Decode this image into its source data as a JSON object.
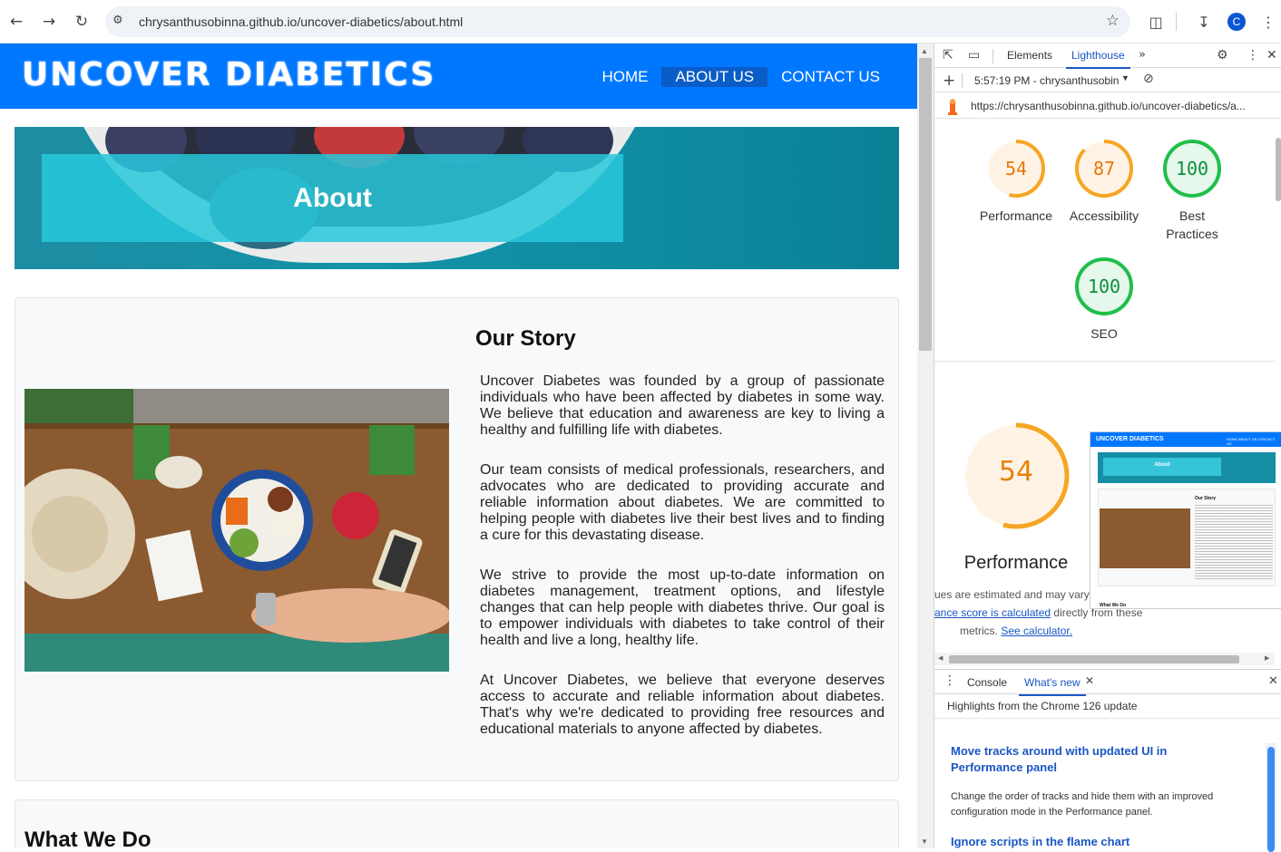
{
  "browser": {
    "url": "chrysanthusobinna.github.io/uncover-diabetics/about.html",
    "profile_initial": "C"
  },
  "site": {
    "brand": "UNCOVER DIABETICS",
    "nav": [
      {
        "label": "HOME",
        "active": false
      },
      {
        "label": "ABOUT US",
        "active": true
      },
      {
        "label": "CONTACT US",
        "active": false
      }
    ],
    "hero_title": "About",
    "story": {
      "heading": "Our Story",
      "paragraphs": [
        "Uncover Diabetes was founded by a group of passionate individuals who have been affected by diabetes in some way. We believe that education and awareness are key to living a healthy and fulfilling life with diabetes.",
        "Our team consists of medical professionals, researchers, and advocates who are dedicated to providing accurate and reliable information about diabetes. We are committed to helping people with diabetes live their best lives and to finding a cure for this devastating disease.",
        "We strive to provide the most up-to-date information on diabetes management, treatment options, and lifestyle changes that can help people with diabetes thrive. Our goal is to empower individuals with diabetes to take control of their health and live a long, healthy life.",
        "At Uncover Diabetes, we believe that everyone deserves access to accurate and reliable information about diabetes. That's why we're dedicated to providing free resources and educational materials to anyone affected by diabetes."
      ]
    },
    "what_we_do_heading": "What We Do"
  },
  "devtools": {
    "tabs": [
      "Elements",
      "Lighthouse"
    ],
    "active_tab": "Lighthouse",
    "report_time": "5:57:19 PM - chrysanthusobinr",
    "report_url": "https://chrysanthusobinna.github.io/uncover-diabetics/a...",
    "scores": [
      {
        "label": "Performance",
        "value": 54,
        "color": "#e8770a",
        "bg": "#fff3e6"
      },
      {
        "label": "Accessibility",
        "value": 87,
        "color": "#e8770a",
        "bg": "#fff3e6"
      },
      {
        "label": "Best Practices",
        "value": 100,
        "color": "#0c8f3a",
        "bg": "#e6f7ec"
      },
      {
        "label": "SEO",
        "value": 100,
        "color": "#0c8f3a",
        "bg": "#e6f7ec"
      }
    ],
    "big": {
      "value": 54,
      "label": "Performance"
    },
    "note1": "ues are estimated and may vary",
    "note2_link": "ance score is calculated",
    "note2_rest": " directly from these",
    "note3_text": "metrics. ",
    "note3_link": "See calculator.",
    "thumb": {
      "brand": "UNCOVER DIABETICS",
      "nav": [
        "HOME",
        "ABOUT US",
        "CONTACT US"
      ],
      "hero": "About",
      "heading": "Our Story",
      "footer": "What We Do"
    },
    "drawer": {
      "tabs": [
        "Console",
        "What's new"
      ],
      "active": "What's new",
      "subtitle": "Highlights from the Chrome 126 update",
      "items": [
        {
          "title": "Move tracks around with updated UI in Performance panel",
          "desc": "Change the order of tracks and hide them with an improved configuration mode in the Performance panel."
        },
        {
          "title": "Ignore scripts in the flame chart",
          "desc": ""
        }
      ]
    }
  }
}
